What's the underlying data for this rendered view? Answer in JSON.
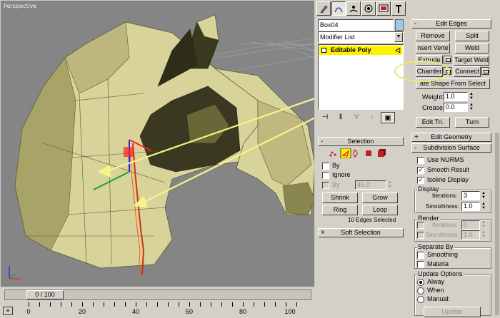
{
  "viewport": {
    "label": "Perspective"
  },
  "timeline": {
    "frame_display": "0 / 100",
    "ticks": [
      "0",
      "20",
      "40",
      "60",
      "80",
      "100"
    ]
  },
  "command_panel": {
    "tabs": [
      "create-icon",
      "modify-icon",
      "hierarchy-icon",
      "motion-icon",
      "display-icon",
      "utilities-icon"
    ],
    "object_name": "Box04",
    "object_color": "#9ccbe8",
    "modifier_list": "Modifier List",
    "stack_item": "Editable Poly",
    "edit_edges": {
      "title": "Edit Edges",
      "remove": "Remove",
      "split": "Split",
      "insert_vertex": "nsert Verte",
      "weld": "Weld",
      "extrude": "Extrude",
      "target_weld": "Target Weld",
      "chamfer": "Chamfer",
      "connect": "Connect",
      "create_shape": "ate Shape From Select",
      "weight_label": "Weight:",
      "weight_value": "1.0",
      "crease_label": "Crease:",
      "crease_value": "0.0",
      "edit_tri": "Edit Tri.",
      "turn": "Turn"
    },
    "edit_geometry": {
      "title": "Edit Geometry"
    },
    "subdivision": {
      "title": "Subdivision Surface",
      "use_nurms": "Use NURMS",
      "smooth_result": "Smooth Result",
      "isoline_display": "Isoline Display",
      "display_group": "Display",
      "iterations_label": "Iterations:",
      "iterations_value": "3",
      "smoothness_label": "Smoothness:",
      "smoothness_value": "1.0",
      "render_group": "Render",
      "render_iterations_value": "0",
      "render_smoothness_value": "1.0",
      "separate_by": "Separate By",
      "smoothing": "Smoothing",
      "materia": "Materia",
      "update_options": "Update Options",
      "always": "Alway",
      "when": "When",
      "manual": "Manual:",
      "update": "Update"
    },
    "selection": {
      "title": "Selection",
      "by_label": "By",
      "ignore_label": "Ignore",
      "by_angle_label": "By",
      "by_angle_value": "45.0",
      "shrink": "Shrink",
      "grow": "Grow",
      "ring": "Ring",
      "loop": "Loop",
      "status": "10 Edges Selected"
    },
    "soft_selection": {
      "title": "Soft Selection"
    }
  }
}
